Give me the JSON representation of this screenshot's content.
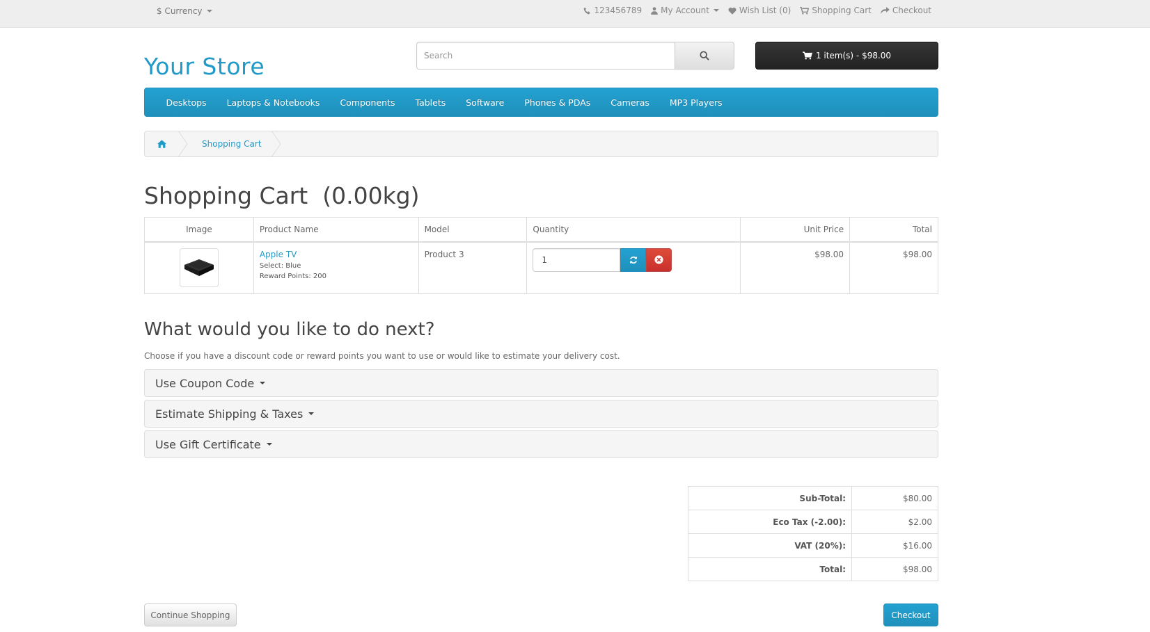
{
  "topbar": {
    "currency_label": "$ Currency",
    "links": [
      {
        "icon": "phone-icon",
        "label": "123456789"
      },
      {
        "icon": "user-icon",
        "label": "My Account"
      },
      {
        "icon": "heart-icon",
        "label": "Wish List (0)"
      },
      {
        "icon": "cart-icon",
        "label": "Shopping Cart"
      },
      {
        "icon": "share-icon",
        "label": "Checkout"
      }
    ]
  },
  "header": {
    "logo": "Your Store",
    "search_placeholder": "Search",
    "cart_button": "1 item(s) - $98.00"
  },
  "menu": [
    "Desktops",
    "Laptops & Notebooks",
    "Components",
    "Tablets",
    "Software",
    "Phones & PDAs",
    "Cameras",
    "MP3 Players"
  ],
  "breadcrumb": {
    "current": "Shopping Cart"
  },
  "page_title": "Shopping Cart  (0.00kg)",
  "cart": {
    "headers": [
      "Image",
      "Product Name",
      "Model",
      "Quantity",
      "Unit Price",
      "Total"
    ],
    "rows": [
      {
        "name": "Apple TV",
        "option": "Select: Blue",
        "reward": "Reward Points: 200",
        "model": "Product 3",
        "quantity": "1",
        "unit_price": "$98.00",
        "total": "$98.00"
      }
    ]
  },
  "next": {
    "heading": "What would you like to do next?",
    "description": "Choose if you have a discount code or reward points you want to use or would like to estimate your delivery cost.",
    "panels": [
      "Use Coupon Code",
      "Estimate Shipping & Taxes",
      "Use Gift Certificate"
    ]
  },
  "totals": [
    {
      "label": "Sub-Total:",
      "value": "$80.00"
    },
    {
      "label": "Eco Tax (-2.00):",
      "value": "$2.00"
    },
    {
      "label": "VAT (20%):",
      "value": "$16.00"
    },
    {
      "label": "Total:",
      "value": "$98.00"
    }
  ],
  "buttons": {
    "continue": "Continue Shopping",
    "checkout": "Checkout"
  },
  "colors": {
    "accent": "#229ac8",
    "danger": "#dd4b39",
    "dark": "#222222"
  }
}
